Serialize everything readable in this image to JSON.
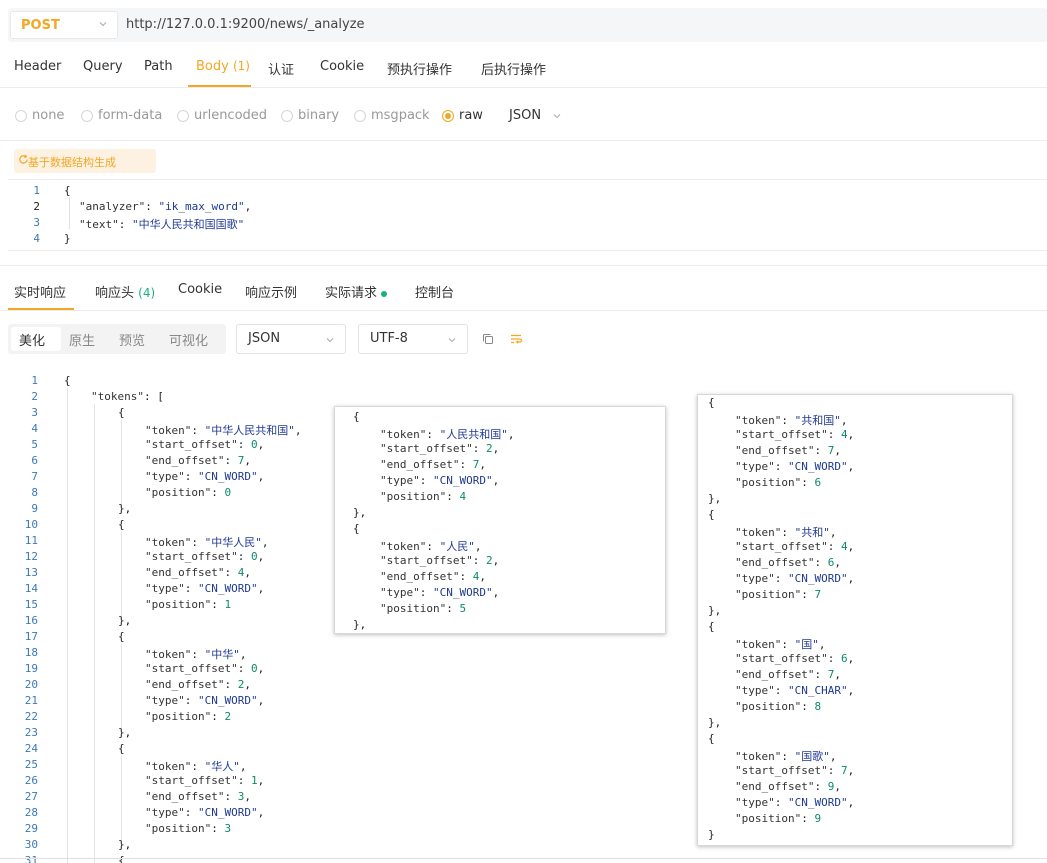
{
  "request": {
    "method": "POST",
    "url": "http://127.0.0.1:9200/news/_analyze",
    "tabs": [
      {
        "label": "Header"
      },
      {
        "label": "Query"
      },
      {
        "label": "Path"
      },
      {
        "label": "Body",
        "badge": "(1)"
      },
      {
        "label": "认证"
      },
      {
        "label": "Cookie"
      },
      {
        "label": "预执行操作"
      },
      {
        "label": "后执行操作"
      }
    ],
    "active_tab": "Body",
    "body_types": [
      "none",
      "form-data",
      "urlencoded",
      "binary",
      "msgpack",
      "raw"
    ],
    "selected_body_type": "raw",
    "format": "JSON",
    "generate_button": "基于数据结构生成",
    "body_lines": [
      {
        "num": "1",
        "text": "{"
      },
      {
        "num": "2",
        "key": "\"analyzer\"",
        "sep": ": ",
        "value": "\"ik_max_word\"",
        "end": ","
      },
      {
        "num": "3",
        "key": "\"text\"",
        "sep": ": ",
        "value": "\"中华人民共和国国歌\"",
        "end": ""
      },
      {
        "num": "4",
        "text": "}"
      }
    ]
  },
  "response": {
    "tabs": [
      {
        "label": "实时响应"
      },
      {
        "label": "响应头",
        "badge": "(4)"
      },
      {
        "label": "Cookie"
      },
      {
        "label": "响应示例"
      },
      {
        "label": "实际请求"
      },
      {
        "label": "控制台"
      }
    ],
    "active_tab": "实时响应",
    "view_modes": [
      "美化",
      "原生",
      "预览",
      "可视化"
    ],
    "active_view_mode": "美化",
    "format_select": "JSON",
    "encoding_select": "UTF-8",
    "line_numbers": [
      "1",
      "2",
      "3",
      "4",
      "5",
      "6",
      "7",
      "8",
      "9",
      "10",
      "11",
      "12",
      "13",
      "14",
      "15",
      "16",
      "17",
      "18",
      "19",
      "20",
      "21",
      "22",
      "23",
      "24",
      "25",
      "26",
      "27",
      "28",
      "29",
      "30",
      "31"
    ],
    "main_lines": [
      "{",
      "\"tokens\": [",
      "{",
      "\"token\": \"中华人民共和国\",",
      "\"start_offset\": 0,",
      "\"end_offset\": 7,",
      "\"type\": \"CN_WORD\",",
      "\"position\": 0",
      "},",
      "{",
      "\"token\": \"中华人民\",",
      "\"start_offset\": 0,",
      "\"end_offset\": 4,",
      "\"type\": \"CN_WORD\",",
      "\"position\": 1",
      "},",
      "{",
      "\"token\": \"中华\",",
      "\"start_offset\": 0,",
      "\"end_offset\": 2,",
      "\"type\": \"CN_WORD\",",
      "\"position\": 2",
      "},",
      "{",
      "\"token\": \"华人\",",
      "\"start_offset\": 1,",
      "\"end_offset\": 3,",
      "\"type\": \"CN_WORD\",",
      "\"position\": 3",
      "},",
      "{"
    ],
    "panel_middle": [
      "{",
      "\"token\": \"人民共和国\",",
      "\"start_offset\": 2,",
      "\"end_offset\": 7,",
      "\"type\": \"CN_WORD\",",
      "\"position\": 4",
      "},",
      "{",
      "\"token\": \"人民\",",
      "\"start_offset\": 2,",
      "\"end_offset\": 4,",
      "\"type\": \"CN_WORD\",",
      "\"position\": 5",
      "},"
    ],
    "panel_right": [
      "{",
      "\"token\": \"共和国\",",
      "\"start_offset\": 4,",
      "\"end_offset\": 7,",
      "\"type\": \"CN_WORD\",",
      "\"position\": 6",
      "},",
      "{",
      "\"token\": \"共和\",",
      "\"start_offset\": 4,",
      "\"end_offset\": 6,",
      "\"type\": \"CN_WORD\",",
      "\"position\": 7",
      "},",
      "{",
      "\"token\": \"国\",",
      "\"start_offset\": 6,",
      "\"end_offset\": 7,",
      "\"type\": \"CN_CHAR\",",
      "\"position\": 8",
      "},",
      "{",
      "\"token\": \"国歌\",",
      "\"start_offset\": 7,",
      "\"end_offset\": 9,",
      "\"type\": \"CN_WORD\",",
      "\"position\": 9",
      "}"
    ]
  },
  "colors": {
    "accent": "#f5a623",
    "status_green": "#19b37a",
    "line_number": "#3a7ab8"
  },
  "icons": [
    "chevron-down-icon",
    "refresh-icon",
    "copy-icon",
    "wrap-lines-icon"
  ]
}
